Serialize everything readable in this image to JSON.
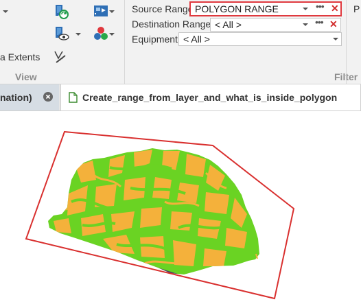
{
  "ribbon": {
    "extents_label": "a Extents",
    "view_group_label": "View",
    "filter_group_label": "Filter",
    "icons": [
      "layer-refresh-icon",
      "layer-visibility-icon",
      "ruler-measure-icon",
      "map-frame-icon",
      "color-palette-icon"
    ],
    "source_range": {
      "label": "Source Range",
      "value": "POLYGON RANGE"
    },
    "destination_range": {
      "label": "Destination Range",
      "value": "< All >"
    },
    "equipment": {
      "label": "Equipment",
      "value": "< All >"
    },
    "right_cut_label": "P"
  },
  "tabs": [
    {
      "label": "nation)",
      "active": false
    },
    {
      "label": "Create_range_from_layer_and_what_is_inside_polygon",
      "active": true
    }
  ],
  "map": {
    "polygon_color": "#d9302f",
    "field_colors": {
      "green": "#6ad323",
      "orange": "#f4b13b"
    }
  }
}
